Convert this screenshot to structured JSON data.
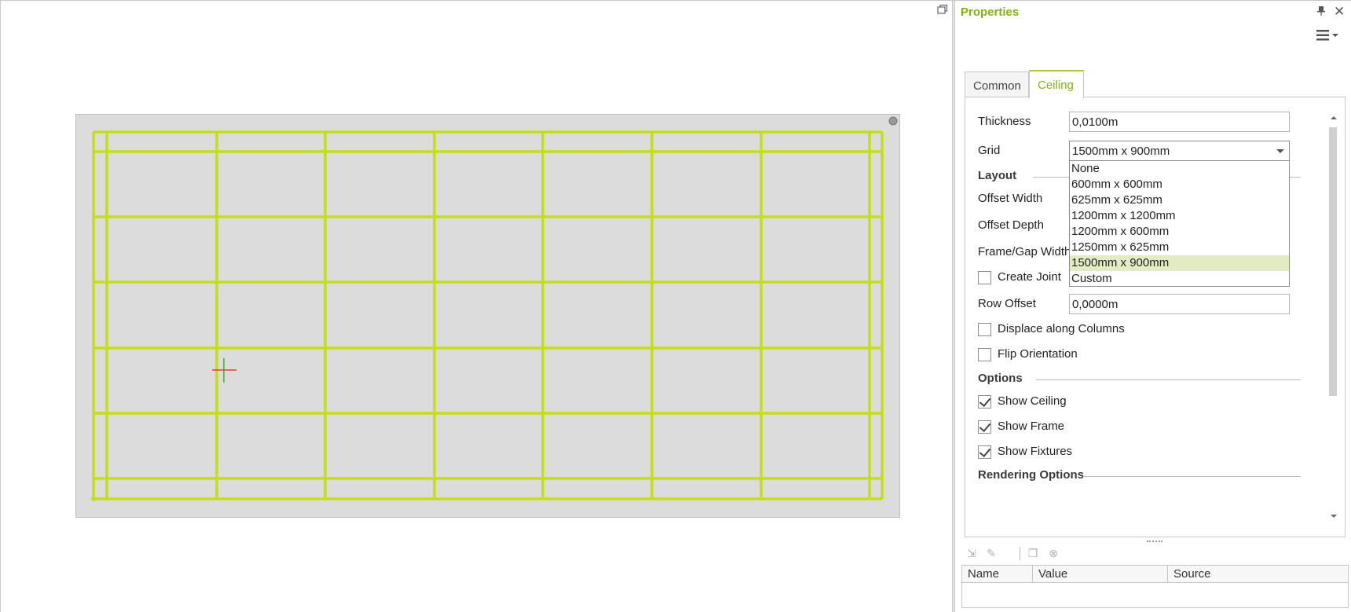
{
  "panel": {
    "title": "Properties",
    "tabs": [
      {
        "label": "Common",
        "active": false
      },
      {
        "label": "Ceiling",
        "active": true
      }
    ],
    "thickness": {
      "label": "Thickness",
      "value": "0,0100m"
    },
    "grid": {
      "label": "Grid",
      "value": "1500mm x 900mm",
      "options": [
        "None",
        "600mm x 600mm",
        "625mm x 625mm",
        "1200mm x 1200mm",
        "1200mm x 600mm",
        "1250mm x 625mm",
        "1500mm x 900mm",
        "Custom"
      ],
      "selected_index": 6
    },
    "layout": {
      "heading": "Layout",
      "offset_width_label": "Offset Width",
      "offset_depth_label": "Offset Depth",
      "frame_gap_width_label": "Frame/Gap Width",
      "create_joint_label": "Create Joint",
      "row_offset_label": "Row Offset",
      "row_offset_value": "0,0000m",
      "displace_label": "Displace along Columns",
      "flip_label": "Flip Orientation"
    },
    "options": {
      "heading": "Options",
      "show_ceiling_label": "Show Ceiling",
      "show_frame_label": "Show Frame",
      "show_fixtures_label": "Show Fixtures"
    },
    "rendering": {
      "heading": "Rendering Options"
    },
    "table": {
      "columns": [
        "Name",
        "Value",
        "Source"
      ]
    }
  },
  "colors": {
    "accent": "#84b014",
    "grid_line": "#c6dd1a",
    "ceiling_fill": "#dcdcdc",
    "selected_option": "#e2ebc2"
  },
  "icons": [
    "restore-icon",
    "pin-icon",
    "close-icon",
    "menu-icon",
    "crosshair-icon"
  ]
}
